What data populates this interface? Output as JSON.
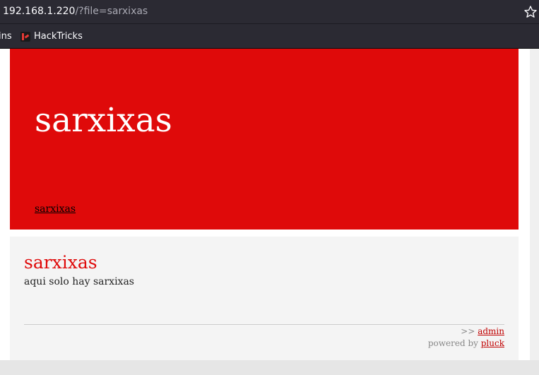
{
  "browser": {
    "url_host": "192.168.1.220",
    "url_path": "/?file=sarxixas",
    "bookmarks": [
      {
        "label": "ins"
      },
      {
        "label": "HackTricks"
      }
    ]
  },
  "site": {
    "title": "sarxixas",
    "nav_link": "sarxixas",
    "page_heading": "sarxixas",
    "page_text": "aqui solo hay sarxixas",
    "footer_admin_prefix": ">>",
    "footer_admin_link": "admin",
    "footer_powered_prefix": "powered by",
    "footer_powered_link": "pluck"
  },
  "colors": {
    "header_red": "#df0a0a",
    "browser_dark": "#2b2a33"
  },
  "icons": {
    "bookmark_star": "star-icon",
    "hacktricks": "hacktricks-icon"
  }
}
